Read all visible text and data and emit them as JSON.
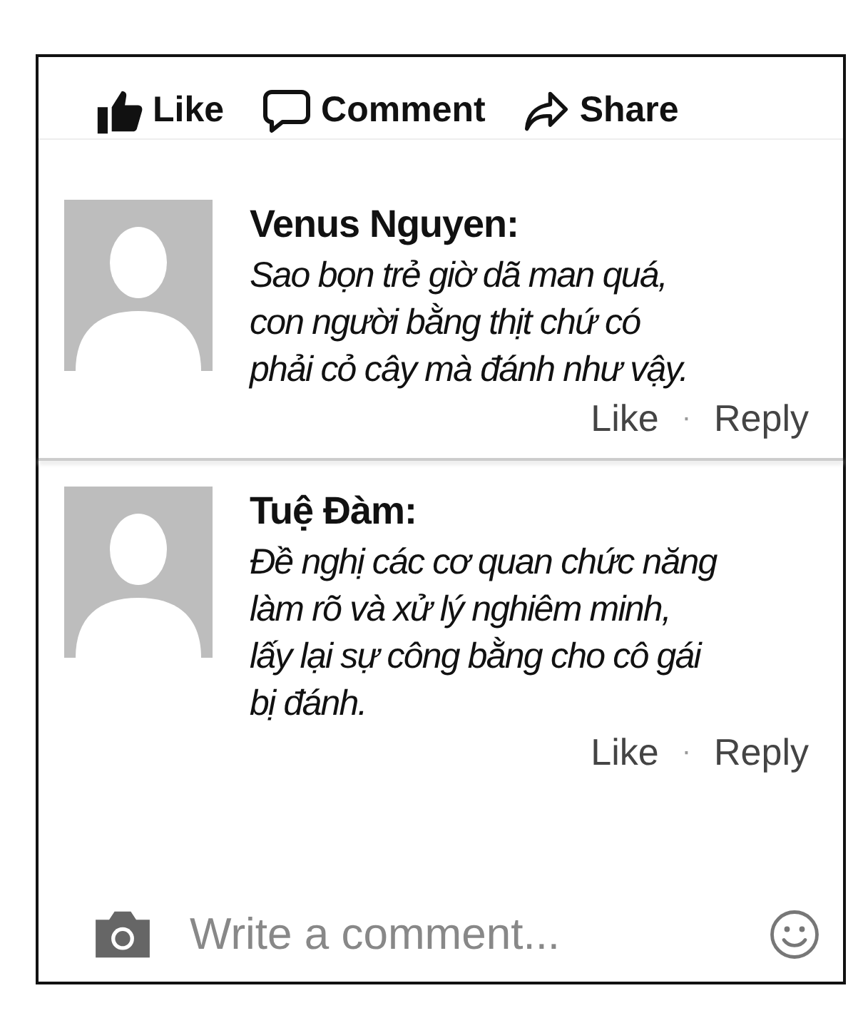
{
  "actions": [
    {
      "kind": "like",
      "label": "Like"
    },
    {
      "kind": "comment",
      "label": "Comment"
    },
    {
      "kind": "share",
      "label": "Share"
    }
  ],
  "comments": [
    {
      "author": "Venus Nguyen:",
      "lines": [
        "Sao bọn trẻ giờ dã man quá,",
        "con người bằng thịt chứ có",
        "phải cỏ cây mà đánh như vậy."
      ],
      "like": "Like",
      "separator": "·",
      "reply": "Reply"
    },
    {
      "author": "Tuệ Đàm:",
      "lines": [
        "Đề nghị các cơ quan chức năng",
        "làm rõ và xử lý nghiêm minh,",
        "lấy lại sự công bằng cho cô gái",
        "bị đánh."
      ],
      "like": "Like",
      "separator": "·",
      "reply": "Reply"
    }
  ],
  "composer": {
    "placeholder": "Write a comment..."
  }
}
